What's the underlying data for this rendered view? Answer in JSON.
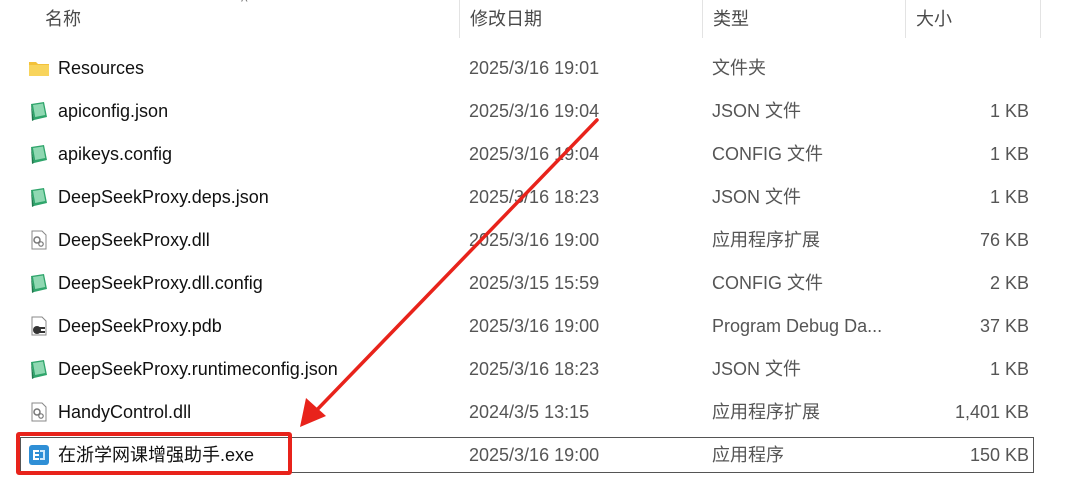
{
  "columns": {
    "name": "名称",
    "date": "修改日期",
    "type": "类型",
    "size": "大小"
  },
  "accent": {
    "annotation": "#e8231b",
    "folder": "#f3c13a",
    "config": "#2fa56b"
  },
  "files": [
    {
      "name": "Resources",
      "date": "2025/3/16 19:01",
      "type": "文件夹",
      "size": "",
      "icon": "folder-icon"
    },
    {
      "name": "apiconfig.json",
      "date": "2025/3/16 19:04",
      "type": "JSON 文件",
      "size": "1 KB",
      "icon": "config-file-icon"
    },
    {
      "name": "apikeys.config",
      "date": "2025/3/16 19:04",
      "type": "CONFIG 文件",
      "size": "1 KB",
      "icon": "config-file-icon"
    },
    {
      "name": "DeepSeekProxy.deps.json",
      "date": "2025/3/16 18:23",
      "type": "JSON 文件",
      "size": "1 KB",
      "icon": "config-file-icon"
    },
    {
      "name": "DeepSeekProxy.dll",
      "date": "2025/3/16 19:00",
      "type": "应用程序扩展",
      "size": "76 KB",
      "icon": "dll-file-icon"
    },
    {
      "name": "DeepSeekProxy.dll.config",
      "date": "2025/3/15 15:59",
      "type": "CONFIG 文件",
      "size": "2 KB",
      "icon": "config-file-icon"
    },
    {
      "name": "DeepSeekProxy.pdb",
      "date": "2025/3/16 19:00",
      "type": "Program Debug Da...",
      "size": "37 KB",
      "icon": "pdb-file-icon"
    },
    {
      "name": "DeepSeekProxy.runtimeconfig.json",
      "date": "2025/3/16 18:23",
      "type": "JSON 文件",
      "size": "1 KB",
      "icon": "config-file-icon"
    },
    {
      "name": "HandyControl.dll",
      "date": "2024/3/5 13:15",
      "type": "应用程序扩展",
      "size": "1,401 KB",
      "icon": "dll-file-icon"
    },
    {
      "name": "在浙学网课增强助手.exe",
      "date": "2025/3/16 19:00",
      "type": "应用程序",
      "size": "150 KB",
      "icon": "exe-app-icon"
    }
  ]
}
